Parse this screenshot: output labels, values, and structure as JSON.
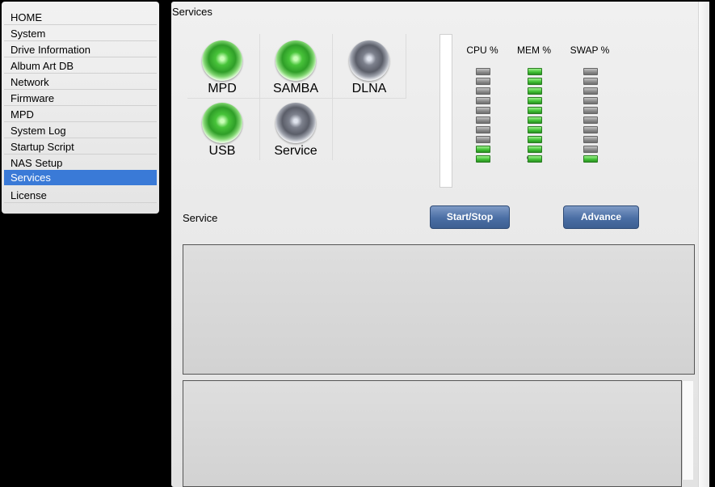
{
  "sidebar": {
    "items": [
      {
        "label": "HOME"
      },
      {
        "label": "System"
      },
      {
        "label": "Drive Information"
      },
      {
        "label": "Album Art DB"
      },
      {
        "label": "Network"
      },
      {
        "label": "Firmware"
      },
      {
        "label": "MPD"
      },
      {
        "label": "System Log"
      },
      {
        "label": "Startup Script"
      },
      {
        "label": "NAS Setup"
      },
      {
        "label": "Services"
      },
      {
        "label": "License"
      }
    ],
    "active_index": 10
  },
  "page": {
    "title": "Services"
  },
  "services": [
    {
      "label": "MPD",
      "state": "on"
    },
    {
      "label": "SAMBA",
      "state": "on"
    },
    {
      "label": "DLNA",
      "state": "off"
    },
    {
      "label": "USB",
      "state": "on"
    },
    {
      "label": "Service",
      "state": "off"
    }
  ],
  "meters": [
    {
      "title": "CPU %",
      "value": "13",
      "lit": 2,
      "total": 10
    },
    {
      "title": "MEM %",
      "value": "94",
      "lit": 10,
      "total": 10
    },
    {
      "title": "SWAP %",
      "value": "7",
      "lit": 1,
      "total": 10
    }
  ],
  "actions": {
    "service_label": "Service",
    "start_stop_label": "Start/Stop",
    "advance_label": "Advance"
  },
  "colors": {
    "active_item": "#3a7ad7",
    "button": "#4a6ea4",
    "led_on": "#3fbf33",
    "led_off": "#8a8a8a"
  }
}
